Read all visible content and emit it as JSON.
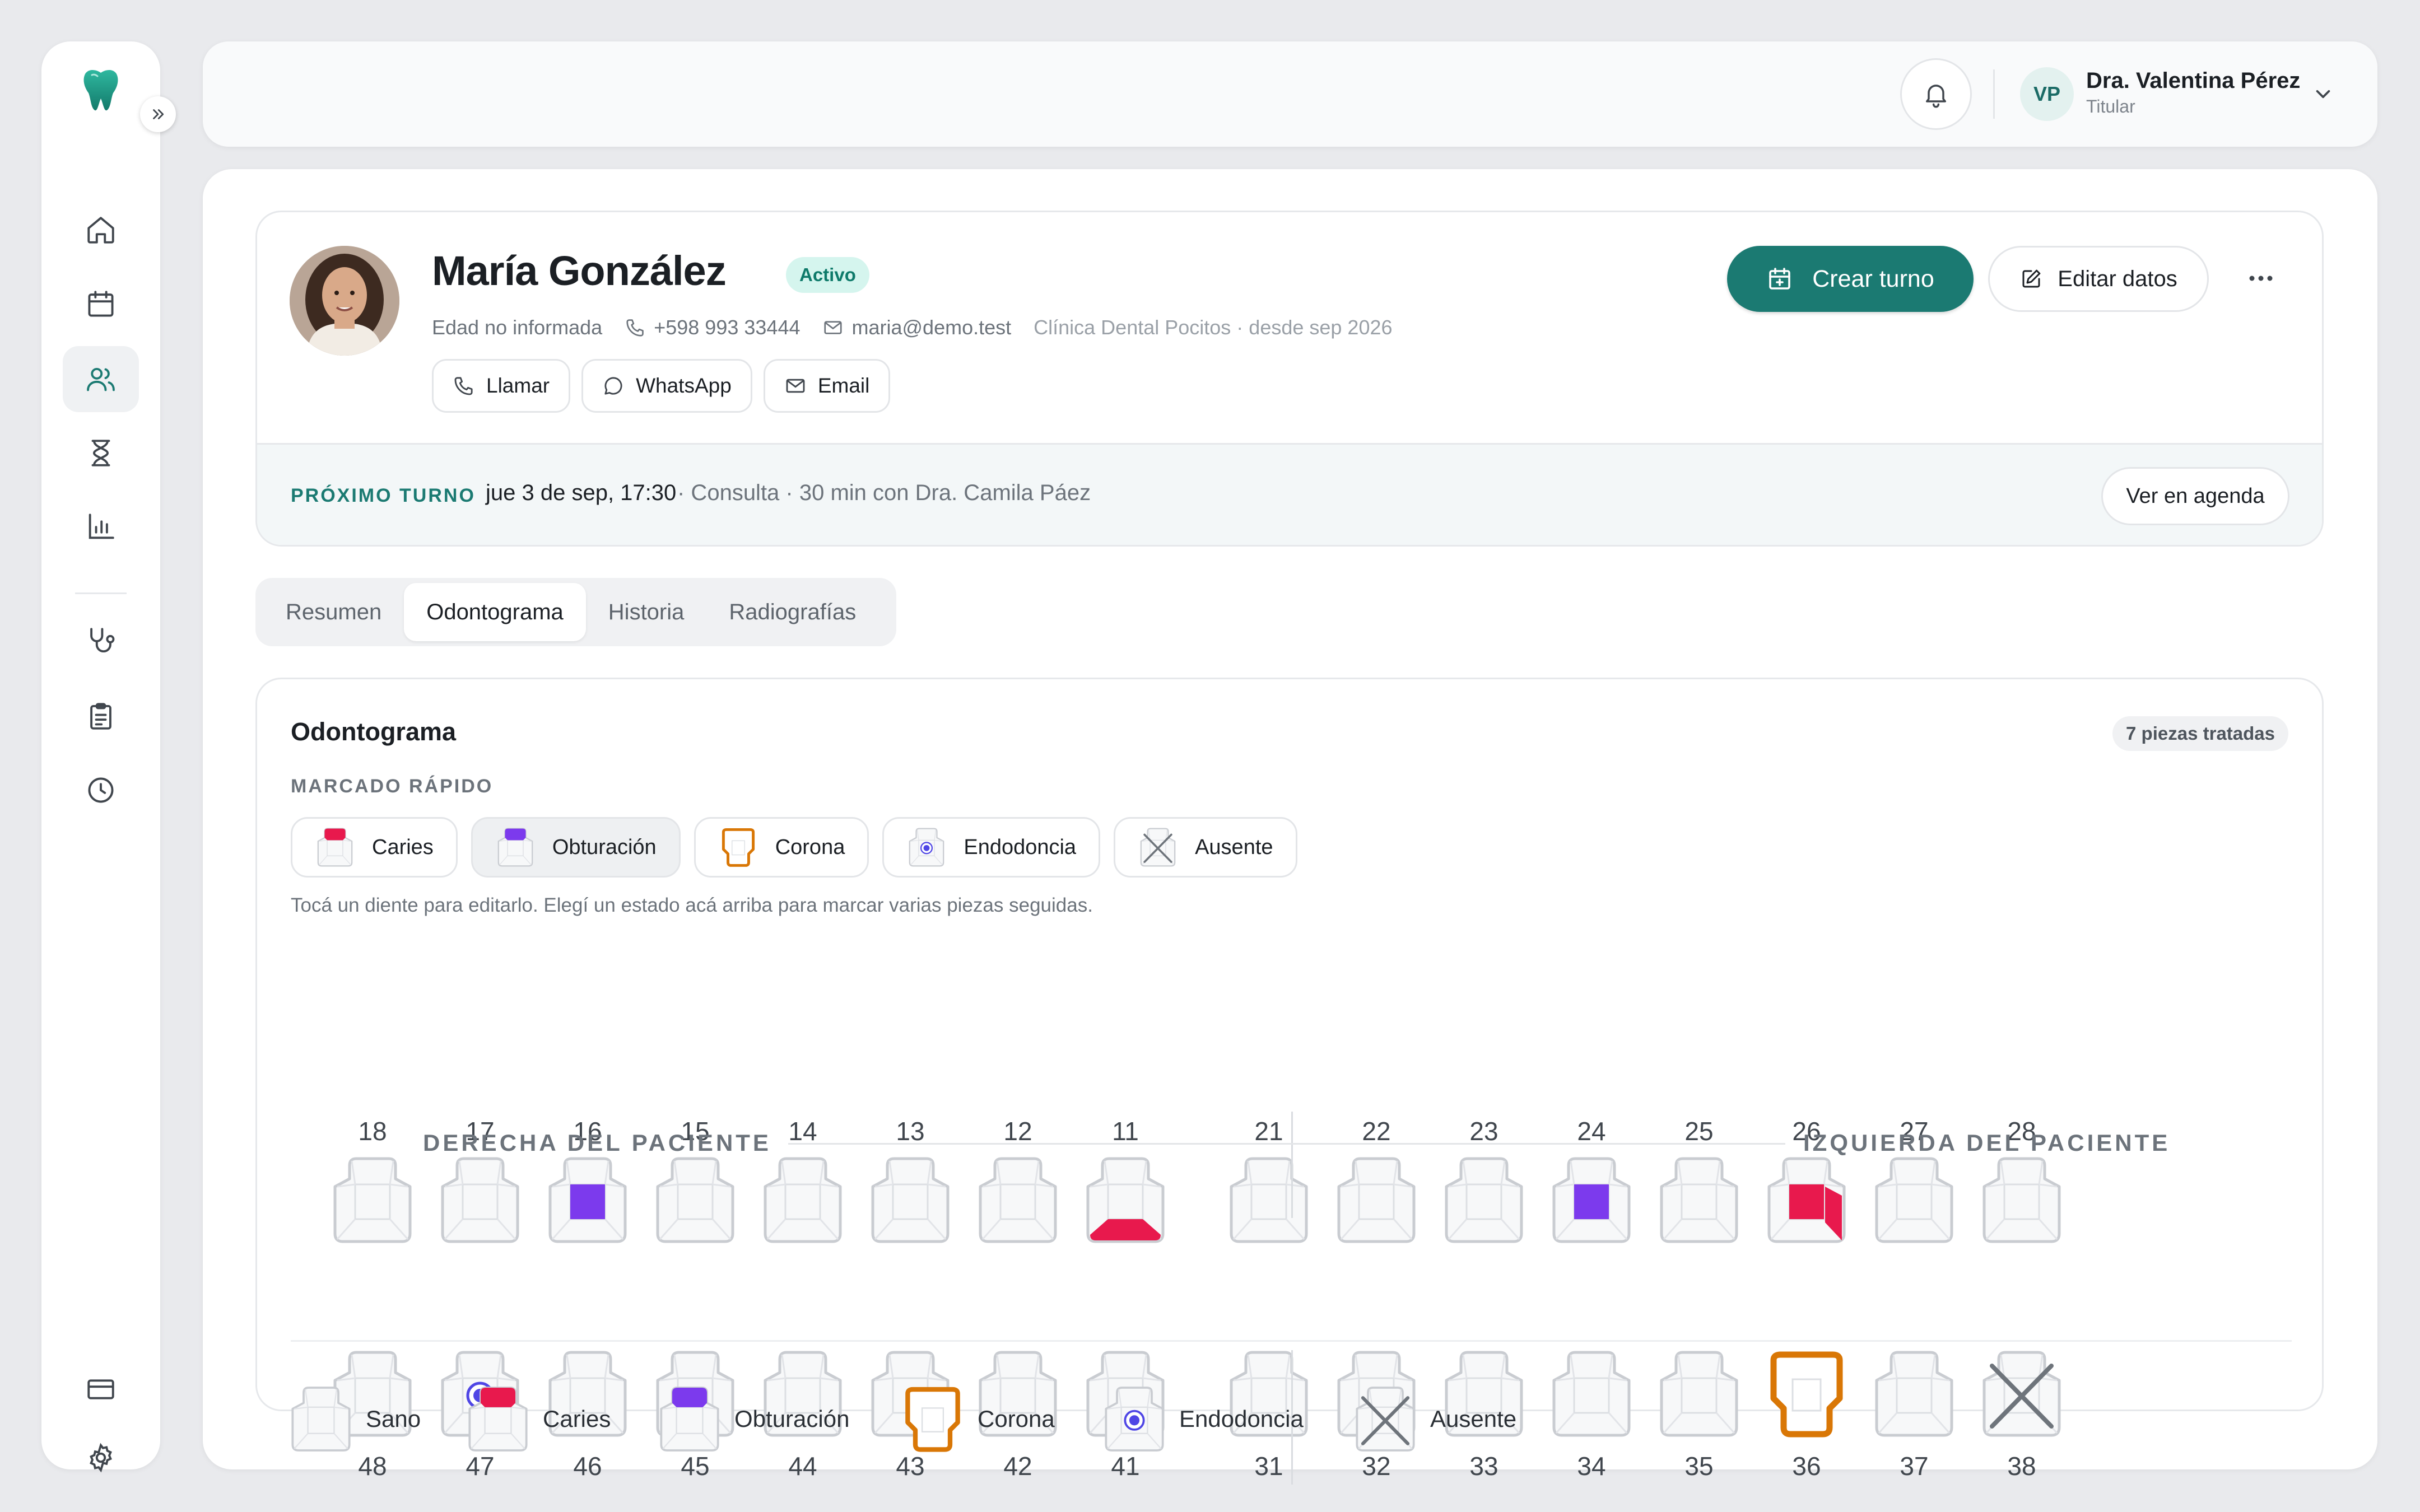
{
  "sidebar": {
    "nav": [
      "home-icon",
      "calendar-icon",
      "patients-icon",
      "hourglass-icon",
      "chart-icon",
      "stethoscope-icon",
      "clipboard-icon",
      "clock-icon",
      "card-icon",
      "gear-icon"
    ],
    "active": "patients-icon"
  },
  "topbar": {
    "user_initials": "VP",
    "user_name": "Dra. Valentina Pérez",
    "user_role": "Titular"
  },
  "patient": {
    "name": "María González",
    "status": "Activo",
    "age": "Edad no informada",
    "phone": "+598 993 33444",
    "email": "maria@demo.test",
    "clinic": "Clínica Dental Pocitos · desde sep 2026",
    "actions": {
      "call": "Llamar",
      "whatsapp": "WhatsApp",
      "email": "Email"
    },
    "create_appointment": "Crear turno",
    "edit_data": "Editar datos"
  },
  "next_appointment": {
    "label": "PRÓXIMO TURNO",
    "date": "jue 3 de sep, 17:30",
    "detail": "· Consulta · 30 min con Dra. Camila Páez",
    "agenda_button": "Ver en agenda"
  },
  "tabs": [
    {
      "label": "Resumen",
      "active": false
    },
    {
      "label": "Odontograma",
      "active": true
    },
    {
      "label": "Historia",
      "active": false
    },
    {
      "label": "Radiografías",
      "active": false
    }
  ],
  "odontogram": {
    "title": "Odontograma",
    "treated": "7 piezas tratadas",
    "quick_label": "MARCADO RÁPIDO",
    "quick_marks": [
      {
        "key": "caries",
        "label": "Caries",
        "selected": false
      },
      {
        "key": "obturacion",
        "label": "Obturación",
        "selected": true
      },
      {
        "key": "corona",
        "label": "Corona",
        "selected": false
      },
      {
        "key": "endodoncia",
        "label": "Endodoncia",
        "selected": false
      },
      {
        "key": "ausente",
        "label": "Ausente",
        "selected": false
      }
    ],
    "hint": "Tocá un diente para editarlo. Elegí un estado acá arriba para marcar varias piezas seguidas.",
    "right_label": "DERECHA DEL PACIENTE",
    "left_label": "IZQUIERDA DEL PACIENTE",
    "upper": [
      {
        "num": "18",
        "state": "sano"
      },
      {
        "num": "17",
        "state": "sano"
      },
      {
        "num": "16",
        "state": "obturacion"
      },
      {
        "num": "15",
        "state": "sano"
      },
      {
        "num": "14",
        "state": "sano"
      },
      {
        "num": "13",
        "state": "sano"
      },
      {
        "num": "12",
        "state": "sano"
      },
      {
        "num": "11",
        "state": "caries-bottom"
      },
      {
        "num": "21",
        "state": "sano"
      },
      {
        "num": "22",
        "state": "sano"
      },
      {
        "num": "23",
        "state": "sano"
      },
      {
        "num": "24",
        "state": "obturacion"
      },
      {
        "num": "25",
        "state": "sano"
      },
      {
        "num": "26",
        "state": "caries-center-side"
      },
      {
        "num": "27",
        "state": "sano"
      },
      {
        "num": "28",
        "state": "sano"
      }
    ],
    "lower": [
      {
        "num": "48",
        "state": "sano"
      },
      {
        "num": "47",
        "state": "endodoncia"
      },
      {
        "num": "46",
        "state": "sano"
      },
      {
        "num": "45",
        "state": "sano"
      },
      {
        "num": "44",
        "state": "sano"
      },
      {
        "num": "43",
        "state": "sano"
      },
      {
        "num": "42",
        "state": "sano"
      },
      {
        "num": "41",
        "state": "sano"
      },
      {
        "num": "31",
        "state": "sano"
      },
      {
        "num": "32",
        "state": "sano"
      },
      {
        "num": "33",
        "state": "sano"
      },
      {
        "num": "34",
        "state": "sano"
      },
      {
        "num": "35",
        "state": "sano"
      },
      {
        "num": "36",
        "state": "corona"
      },
      {
        "num": "37",
        "state": "sano"
      },
      {
        "num": "38",
        "state": "ausente"
      }
    ],
    "legend": [
      {
        "key": "sano",
        "label": "Sano"
      },
      {
        "key": "caries",
        "label": "Caries"
      },
      {
        "key": "obturacion",
        "label": "Obturación"
      },
      {
        "key": "corona",
        "label": "Corona"
      },
      {
        "key": "endodoncia",
        "label": "Endodoncia"
      },
      {
        "key": "ausente",
        "label": "Ausente"
      }
    ]
  },
  "colors": {
    "brand": "#1b7a72",
    "caries": "#e8194d",
    "obturacion": "#7c3aed",
    "corona": "#d97706",
    "endodoncia": "#4f46e5",
    "tooth_stroke": "#c9ccd1",
    "tooth_fill": "#f7f8f9"
  }
}
